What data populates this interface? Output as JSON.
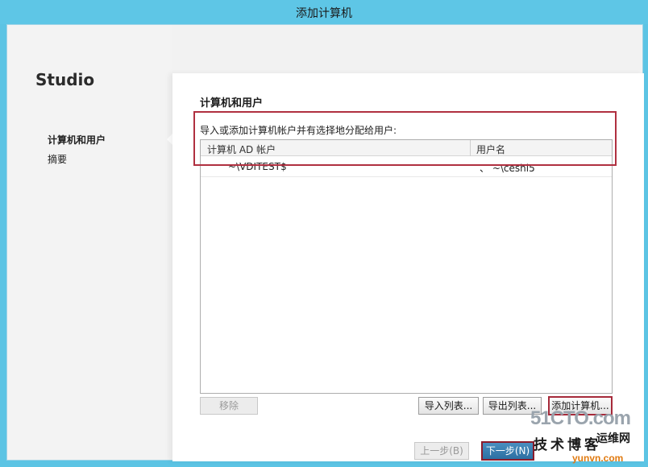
{
  "window": {
    "title": "添加计算机"
  },
  "sidebar": {
    "brand": "Studio",
    "items": [
      {
        "label": "计算机和用户",
        "active": true
      },
      {
        "label": "摘要",
        "active": false
      }
    ]
  },
  "main": {
    "section_title": "计算机和用户",
    "instruction": "导入或添加计算机帐户并有选择地分配给用户:",
    "table": {
      "columns": [
        "计算机 AD 帐户",
        "用户名"
      ],
      "rows": [
        {
          "computer": "~\\VDITEST$",
          "user": "、  ~\\ceshi5"
        }
      ]
    },
    "buttons": {
      "remove": "移除",
      "import": "导入列表...",
      "export": "导出列表...",
      "add_computer": "添加计算机..."
    }
  },
  "footer": {
    "back": "上一步(B)",
    "next": "下一步(N)"
  },
  "watermark": {
    "top": "51CTO.com",
    "mid": "技术博客",
    "yun": "运维网",
    "url": "yunvn.com"
  },
  "colors": {
    "title_bar": "#5ec6e6",
    "highlight_border": "#b03040",
    "primary_button": "#2c6fa2"
  }
}
